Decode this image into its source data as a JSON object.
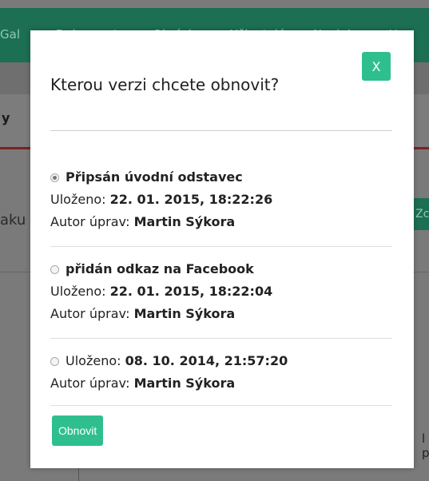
{
  "background": {
    "nav_items": [
      "Gal",
      "Dokumenty",
      "Obrázky",
      "Uživatelé",
      "Novinky",
      "U"
    ],
    "panel_text": "y",
    "left_text": "aku",
    "right_button": "Zc",
    "right_text": "l p"
  },
  "modal": {
    "title": "Kterou verzi chcete obnovit?",
    "close_label": "X",
    "saved_label": "Uloženo:",
    "author_label": "Autor úprav:",
    "versions": [
      {
        "description": "Připsán úvodní odstavec",
        "saved": "22. 01. 2015, 18:22:26",
        "author": "Martin Sýkora",
        "selected": true
      },
      {
        "description": "přidán odkaz na Facebook",
        "saved": "22. 01. 2015, 18:22:04",
        "author": "Martin Sýkora",
        "selected": false
      },
      {
        "description": "",
        "saved": "08. 10. 2014, 21:57:20",
        "author": "Martin Sýkora",
        "selected": false
      }
    ],
    "restore_label": "Obnovit"
  }
}
